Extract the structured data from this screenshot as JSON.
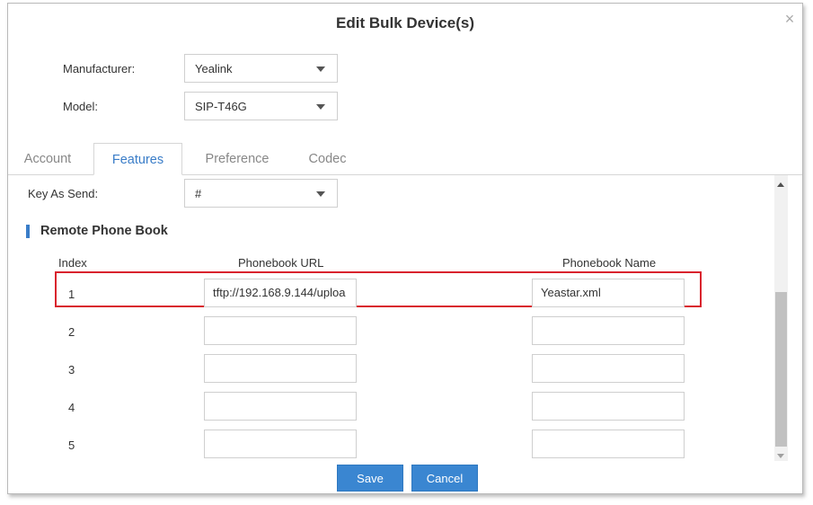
{
  "dialog": {
    "title": "Edit Bulk Device(s)",
    "close_icon": "×"
  },
  "form": {
    "manufacturer_label": "Manufacturer:",
    "manufacturer_value": "Yealink",
    "model_label": "Model:",
    "model_value": "SIP-T46G"
  },
  "tabs": [
    {
      "label": "Account",
      "active": false
    },
    {
      "label": "Features",
      "active": true
    },
    {
      "label": "Preference",
      "active": false
    },
    {
      "label": "Codec",
      "active": false
    }
  ],
  "features": {
    "key_as_send_label": "Key As Send:",
    "key_as_send_value": "#",
    "section_title": "Remote Phone Book",
    "columns": {
      "index": "Index",
      "url": "Phonebook URL",
      "name": "Phonebook Name"
    },
    "rows": [
      {
        "index": "1",
        "url": "tftp://192.168.9.144/uploa",
        "name": "Yeastar.xml"
      },
      {
        "index": "2",
        "url": "",
        "name": ""
      },
      {
        "index": "3",
        "url": "",
        "name": ""
      },
      {
        "index": "4",
        "url": "",
        "name": ""
      },
      {
        "index": "5",
        "url": "",
        "name": ""
      }
    ]
  },
  "buttons": {
    "save": "Save",
    "cancel": "Cancel"
  },
  "colors": {
    "accent": "#3a86d1",
    "highlight": "#d9232d",
    "active_tab": "#3a7dc8"
  }
}
